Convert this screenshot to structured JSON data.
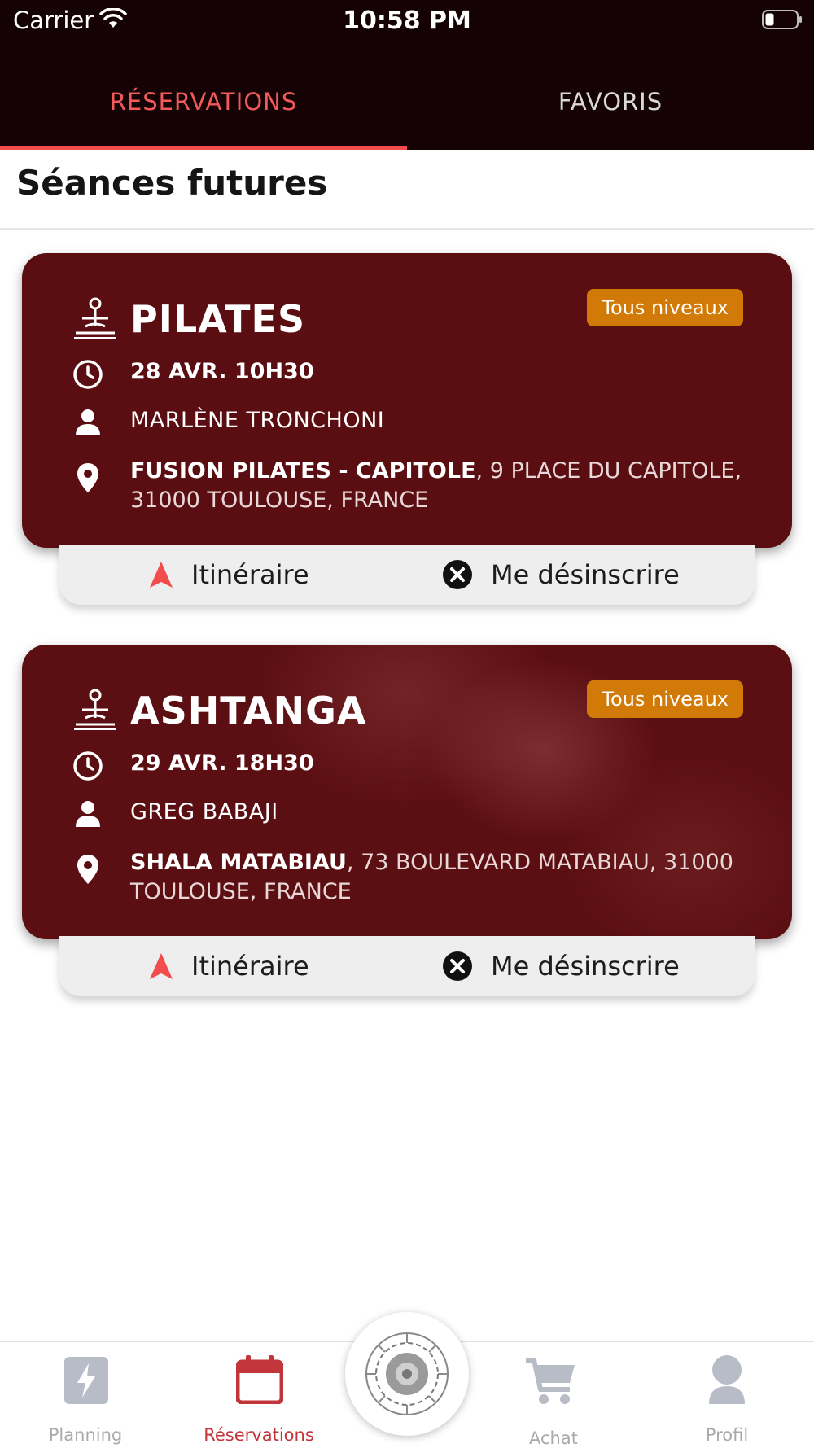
{
  "status_bar": {
    "carrier": "Carrier",
    "time": "10:58 PM"
  },
  "tabs": [
    {
      "label": "RÉSERVATIONS",
      "active": true
    },
    {
      "label": "FAVORIS",
      "active": false
    }
  ],
  "section_title": "Séances futures",
  "cards": [
    {
      "title": "PILATES",
      "badge": "Tous niveaux",
      "date": "28 AVR. 10H30",
      "teacher": "MARLÈNE TRONCHONI",
      "venue": "FUSION PILATES - CAPITOLE",
      "address": ", 9 PLACE DU CAPITOLE, 31000 TOULOUSE, FRANCE",
      "actions": {
        "itinerary": "Itinéraire",
        "unsubscribe": "Me désinscrire"
      }
    },
    {
      "title": "ASHTANGA",
      "badge": "Tous niveaux",
      "date": "29 AVR. 18H30",
      "teacher": "GREG BABAJI",
      "venue": "SHALA MATABIAU",
      "address": ", 73 BOULEVARD MATABIAU, 31000 TOULOUSE, FRANCE",
      "actions": {
        "itinerary": "Itinéraire",
        "unsubscribe": "Me désinscrire"
      }
    }
  ],
  "bottom_nav": [
    {
      "label": "Planning",
      "icon": "lightning-icon",
      "active": false
    },
    {
      "label": "Réservations",
      "icon": "calendar-icon",
      "active": true
    },
    {
      "label": "Achat",
      "icon": "cart-icon",
      "active": false
    },
    {
      "label": "Profil",
      "icon": "user-icon",
      "active": false
    }
  ],
  "colors": {
    "top_bar": "#140204",
    "accent": "#f24c4c",
    "card": "#5a0e12",
    "badge": "#d27a07"
  }
}
